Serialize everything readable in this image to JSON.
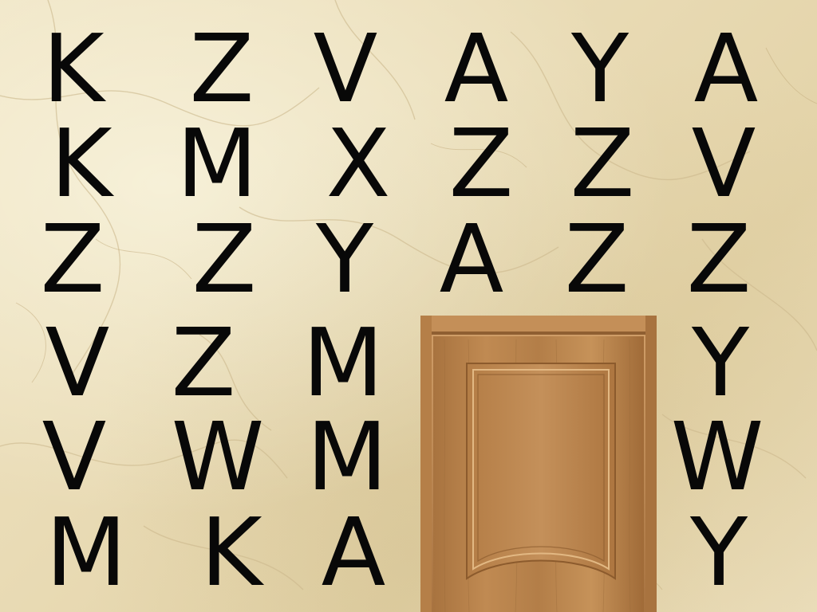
{
  "colors": {
    "background": "#e9dbb5",
    "letter": "#080808",
    "door_wood": "#c08a52",
    "door_dark": "#9a6a3a"
  },
  "door": {
    "icon": "wooden-door"
  },
  "grid": [
    [
      "K",
      "Z",
      "V",
      "A",
      "Y",
      "A"
    ],
    [
      "K",
      "M",
      "X",
      "Z",
      "Z",
      "V"
    ],
    [
      "Z",
      "Z",
      "Y",
      "A",
      "Z",
      "Z"
    ],
    [
      "V",
      "Z",
      "M",
      null,
      null,
      "Y"
    ],
    [
      "V",
      "W",
      "M",
      null,
      null,
      "W"
    ],
    [
      "M",
      "K",
      "A",
      null,
      null,
      "Y"
    ]
  ]
}
